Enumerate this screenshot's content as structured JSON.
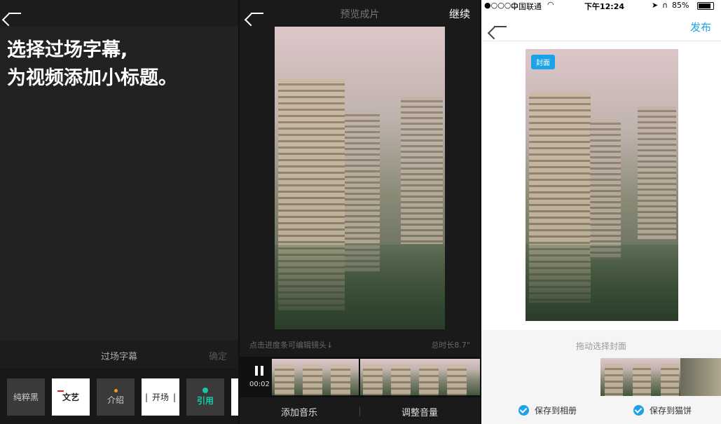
{
  "screen1": {
    "headline_line1": "选择过场字幕,",
    "headline_line2": "为视频添加小标题。",
    "section_title": "过场字幕",
    "confirm_label": "确定",
    "tiles": [
      "纯粹黑",
      "文艺",
      "介绍",
      "开场",
      "引用"
    ]
  },
  "screen2": {
    "title": "预览成片",
    "continue_label": "继续",
    "hint": "点击进度条可编辑镜头↓",
    "total_duration": "总时长8.7\"",
    "elapsed": "00:02",
    "add_music": "添加音乐",
    "adjust_volume": "调整音量"
  },
  "screen3": {
    "status": {
      "signal": "●○○○○",
      "carrier": "中国联通",
      "time": "下午12:24",
      "battery": "85%"
    },
    "publish_label": "发布",
    "cover_badge": "封面",
    "drag_hint": "拖动选择封面",
    "save_album": "保存到相册",
    "save_maobing": "保存到猫饼"
  },
  "icons": [
    "back-arrow-icon",
    "pause-icon",
    "wifi-icon",
    "headphones-icon",
    "location-icon",
    "battery-icon",
    "check-icon"
  ],
  "colors": {
    "accent": "#1aa3e8",
    "teal": "#16c8a8",
    "dark_bg": "#222222"
  }
}
